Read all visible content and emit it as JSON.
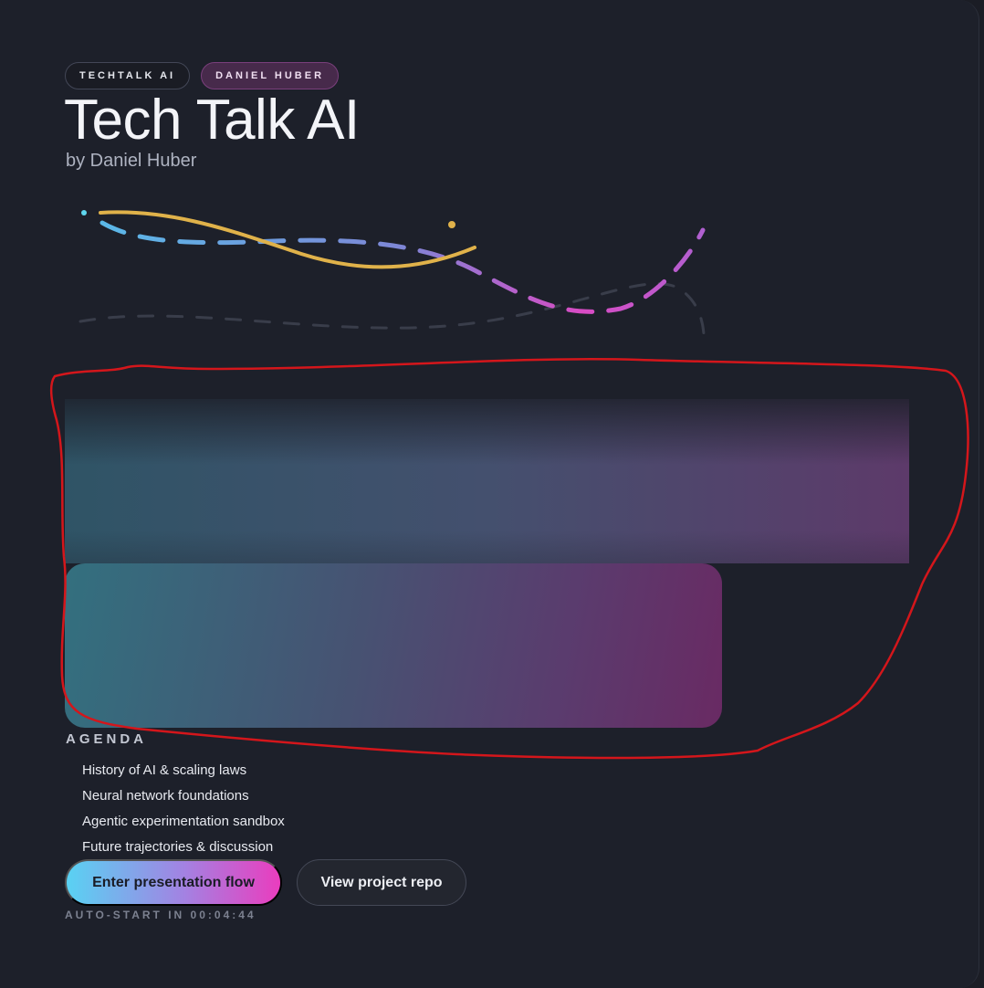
{
  "header": {
    "tags": [
      "TECHTALK AI",
      "DANIEL HUBER"
    ],
    "title": "Tech Talk AI",
    "subtitle": "by Daniel Huber"
  },
  "agenda": {
    "heading": "AGENDA",
    "items": [
      "History of AI & scaling laws",
      "Neural network foundations",
      "Agentic experimentation sandbox",
      "Future trajectories & discussion"
    ]
  },
  "actions": {
    "primary_label": "Enter presentation flow",
    "secondary_label": "View project repo"
  },
  "autostart": {
    "text": "AUTO-START IN 00:04:44"
  },
  "colors": {
    "background": "#1d202a",
    "accent_cyan": "#59d2f3",
    "accent_magenta": "#ea3dbe",
    "accent_yellow": "#e0b24a",
    "annotation_red": "#d4161b"
  }
}
